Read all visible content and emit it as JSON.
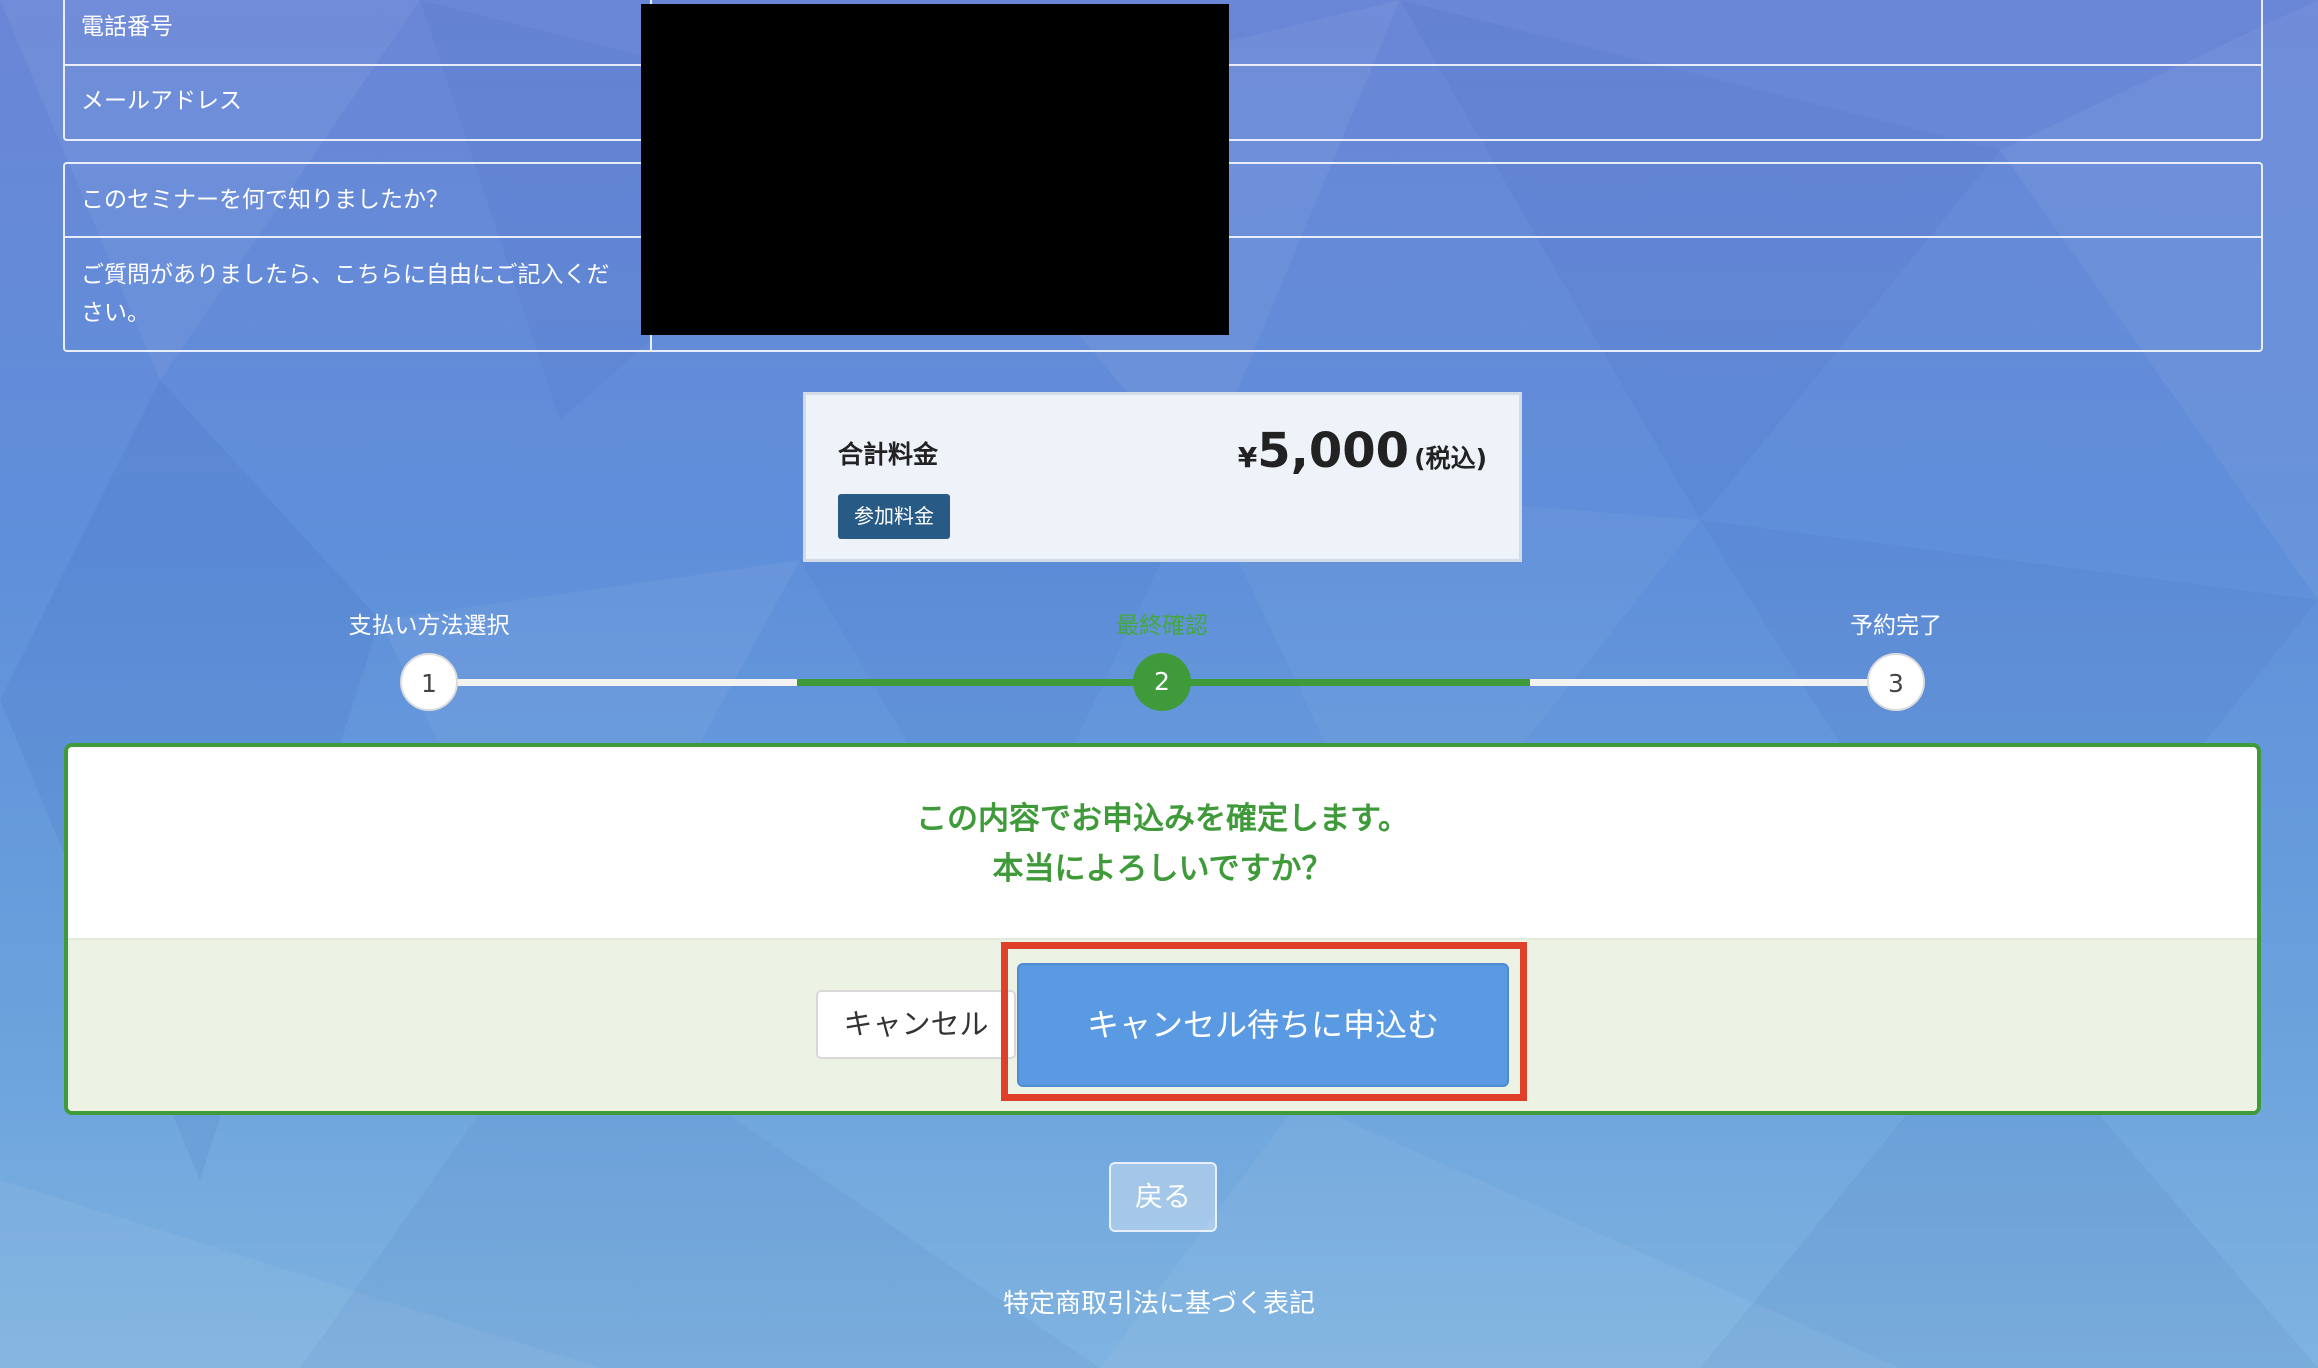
{
  "contact_table": {
    "rows": [
      {
        "label": "電話番号"
      },
      {
        "label": "メールアドレス"
      }
    ]
  },
  "survey_table": {
    "rows": [
      {
        "label": "このセミナーを何で知りましたか？"
      },
      {
        "label": "ご質問がありましたら、こちらに自由にご記入ください。"
      }
    ]
  },
  "price_summary": {
    "label": "合計料金",
    "badge": "参加料金",
    "currency": "¥",
    "amount": "5,000",
    "tax_note": "(税込)"
  },
  "stepper": {
    "current_step": 2,
    "steps": [
      {
        "number": "1",
        "label": "支払い方法選択"
      },
      {
        "number": "2",
        "label": "最終確認"
      },
      {
        "number": "3",
        "label": "予約完了"
      }
    ]
  },
  "confirm": {
    "line1": "この内容でお申込みを確定します。",
    "line2": "本当によろしいですか？",
    "cancel_label": "キャンセル",
    "apply_label": "キャンセル待ちに申込む"
  },
  "back_label": "戻る",
  "legal_link": "特定商取引法に基づく表記",
  "colors": {
    "accent_green": "#3f9a39",
    "primary_blue": "#5a9ae2",
    "highlight_red": "#e0402a",
    "badge_navy": "#285a86"
  }
}
